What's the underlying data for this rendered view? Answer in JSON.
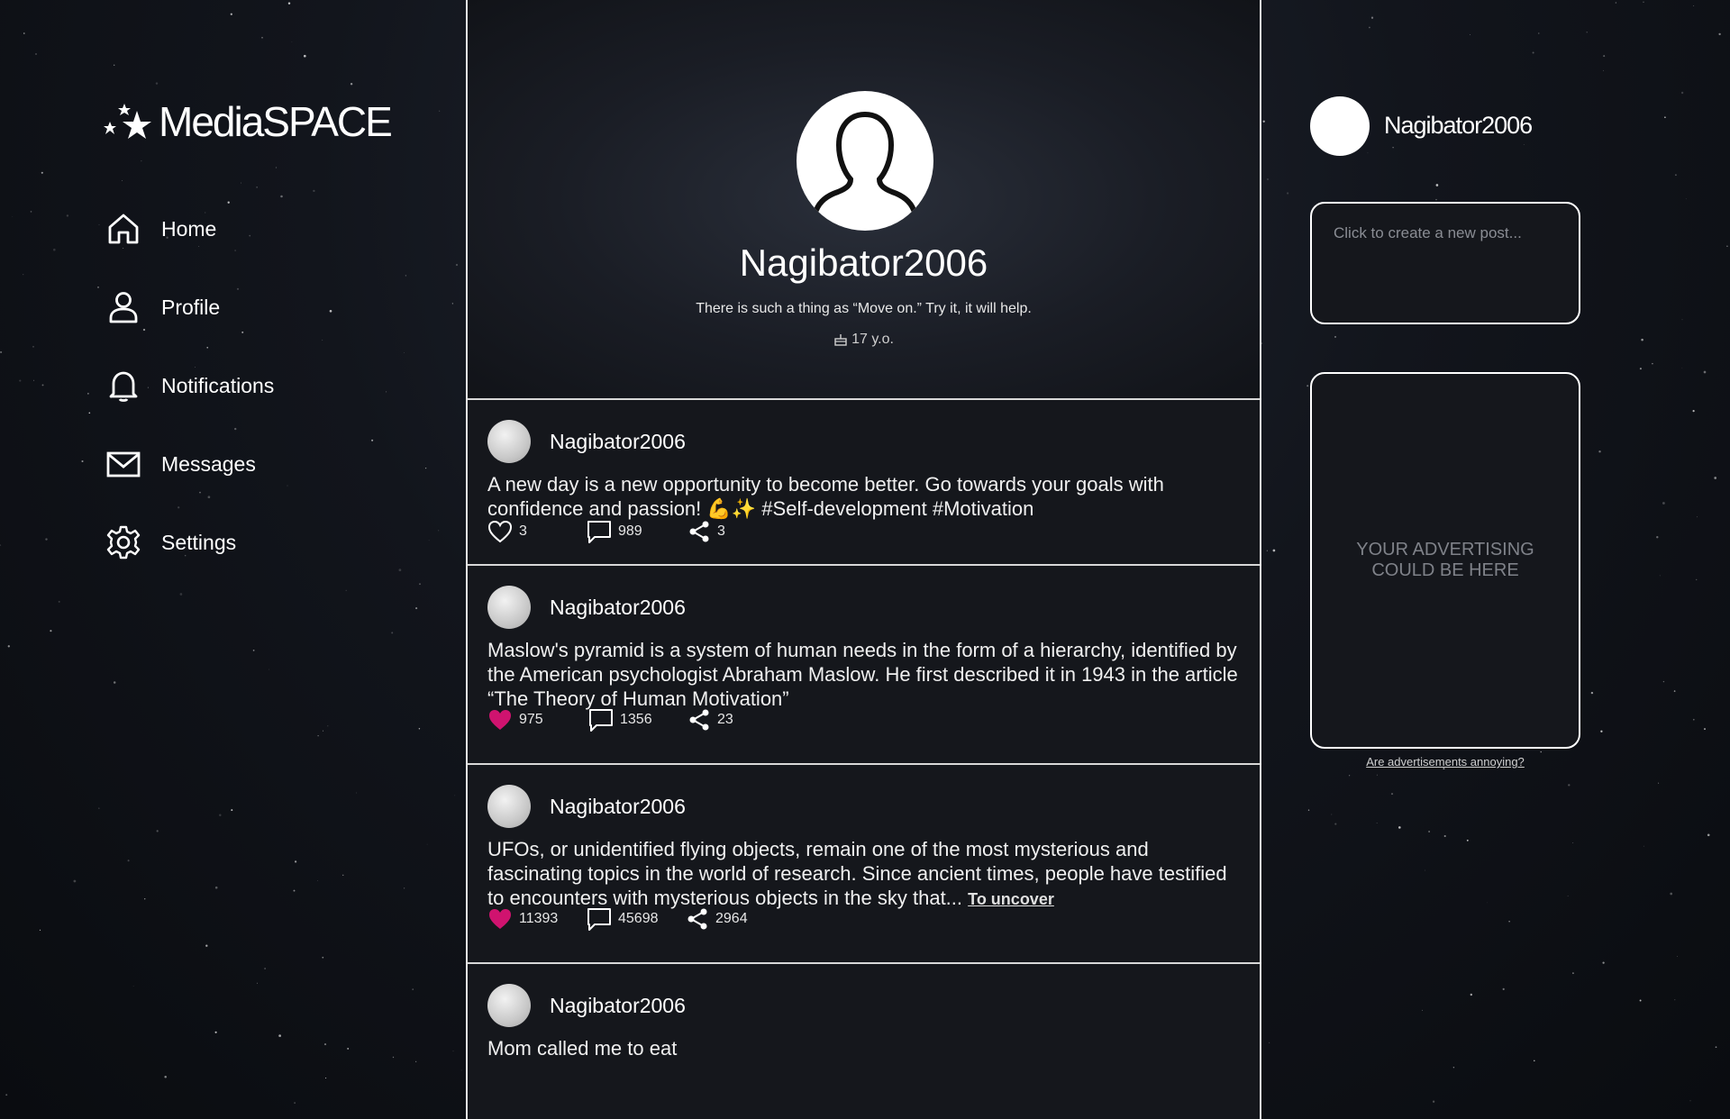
{
  "app": {
    "logo": "MediaSPACE"
  },
  "nav": {
    "items": [
      {
        "label": "Home",
        "icon": "home-icon"
      },
      {
        "label": "Profile",
        "icon": "user-icon"
      },
      {
        "label": "Notifications",
        "icon": "bell-icon"
      },
      {
        "label": "Messages",
        "icon": "mail-icon"
      },
      {
        "label": "Settings",
        "icon": "gear-icon"
      }
    ]
  },
  "profile": {
    "name": "Nagibator2006",
    "bio": "There is such a thing as “Move on.” Try it, it will help.",
    "age": "17 y.o."
  },
  "posts": [
    {
      "author": "Nagibator2006",
      "text": "A new day is a new opportunity to become better. Go towards your goals with confidence and passion! 💪✨ #Self-development #Motivation",
      "likes": "3",
      "liked": false,
      "comments": "989",
      "shares": "3"
    },
    {
      "author": "Nagibator2006",
      "text": "Maslow's pyramid is a system of human needs in the form of a hierarchy, identified by the American psychologist Abraham Maslow. He first described it in 1943 in the article “The Theory of Human Motivation”",
      "likes": "975",
      "liked": true,
      "comments": "1356",
      "shares": "23"
    },
    {
      "author": "Nagibator2006",
      "text": "UFOs, or unidentified flying objects, remain one of the most mysterious and fascinating topics in the world of research. Since ancient times, people have testified to encounters with mysterious objects in the sky that...",
      "more_link": "To uncover",
      "likes": "11393",
      "liked": true,
      "comments": "45698",
      "shares": "2964"
    },
    {
      "author": "Nagibator2006",
      "text": "Mom called me to eat"
    }
  ],
  "sidebar_right": {
    "user": "Nagibator2006",
    "new_post_placeholder": "Click to create a new post...",
    "ad_text": "YOUR ADVERTISING COULD BE HERE",
    "ad_link": "Are advertisements annoying?"
  },
  "colors": {
    "accent_like": "#d0136f",
    "background": "#0c0e13",
    "card": "#15171c"
  }
}
